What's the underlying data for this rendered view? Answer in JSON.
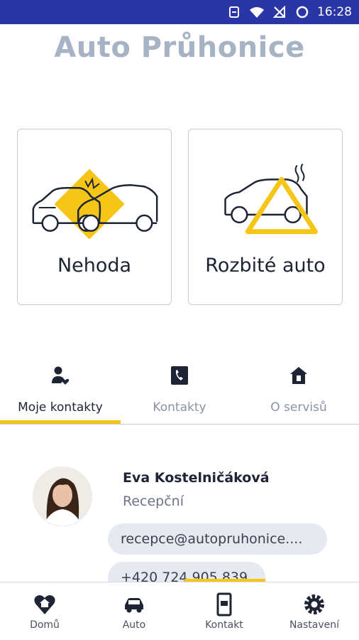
{
  "status_bar": {
    "time": "16:28",
    "icons": [
      "sync-icon",
      "wifi-icon",
      "signal-off-icon",
      "circle-icon"
    ]
  },
  "app": {
    "title": "Auto Průhonice"
  },
  "actions": [
    {
      "label": "Nehoda",
      "icon": "car-crash-icon"
    },
    {
      "label": "Rozbité auto",
      "icon": "broken-car-icon"
    }
  ],
  "tabs": [
    {
      "label": "Moje kontakty",
      "icon": "person-heart-icon",
      "active": true
    },
    {
      "label": "Kontakty",
      "icon": "phone-icon",
      "active": false
    },
    {
      "label": "O servisů",
      "icon": "house-icon",
      "active": false
    }
  ],
  "contact": {
    "name": "Eva Kostelničáková",
    "role": "Recepční",
    "email": "recepce@autopruhonice....",
    "phone": "+420 724 905 839"
  },
  "bottom_nav": [
    {
      "label": "Domů",
      "icon": "heart-home-icon"
    },
    {
      "label": "Auto",
      "icon": "car-icon"
    },
    {
      "label": "Kontakt",
      "icon": "mobile-icon"
    },
    {
      "label": "Nastavení",
      "icon": "gear-icon"
    }
  ],
  "colors": {
    "status_bar": "#2a35a6",
    "accent": "#f5c518",
    "title": "#a6b3c4",
    "text": "#1e2433",
    "pill_bg": "#e6e9ef"
  }
}
